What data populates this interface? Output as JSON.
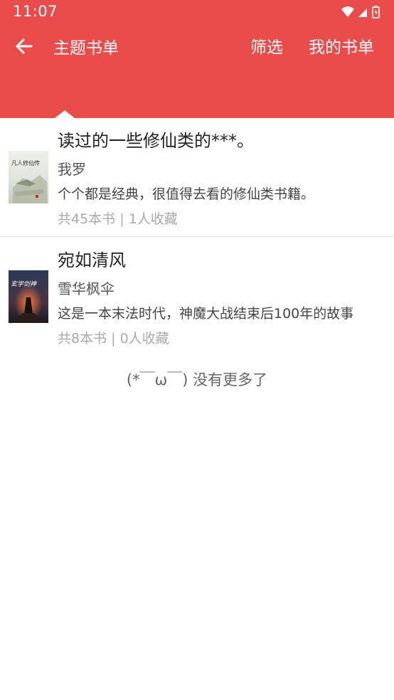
{
  "status_bar": {
    "time": "11:07",
    "icons": [
      "wifi-icon",
      "signal-icon",
      "battery-icon"
    ]
  },
  "toolbar": {
    "back_icon": "arrow-left-icon",
    "title": "主题书单",
    "filter_label": "筛选",
    "my_lists_label": "我的书单"
  },
  "colors": {
    "accent": "#ea4c4c"
  },
  "booklists": [
    {
      "title": "读过的一些修仙类的***。",
      "author": "我罗",
      "description": "个个都是经典，很值得去看的修仙类书籍。",
      "count_label": "共45本书",
      "favorites_label": "1人收藏",
      "cover_text": "凡人修仙传"
    },
    {
      "title": "宛如清风",
      "author": "雪华枫伞",
      "description": "这是一本末法时代，神魔大战结束后100年的故事",
      "count_label": "共8本书",
      "favorites_label": "0人收藏",
      "cover_text": "玄学剑神"
    }
  ],
  "footer": {
    "no_more_text": "(*￣ω￣) 没有更多了"
  }
}
